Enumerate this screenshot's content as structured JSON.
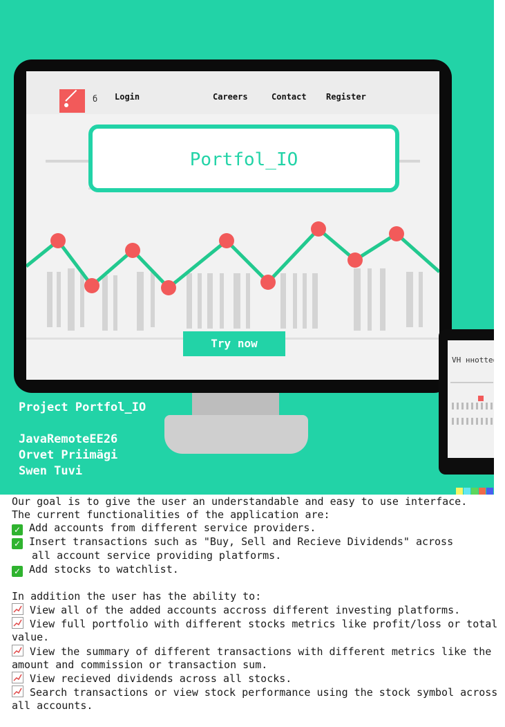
{
  "hero": {
    "nav": {
      "logo_glyph": "б",
      "links": [
        "Login",
        "Careers",
        "Contact",
        "Register"
      ]
    },
    "title": "Portfol_IO",
    "cta": "Try now",
    "project": "Project Portfol_IO",
    "team": [
      "JavaRemoteEE26",
      "Orvet Priimägi",
      "Swen Tuvi"
    ],
    "tablet_label": "VH ннotteɑ"
  },
  "description": {
    "intro": [
      "Our goal is to give the user an understandable and easy to use interface.",
      "The current functionalities of the application are:"
    ],
    "functions": [
      "Add accounts from different service providers.",
      "Insert transactions such as \"Buy, Sell and Recieve Dividends\" across",
      "Add stocks to watchlist."
    ],
    "function_continuation": "all account service providing platforms.",
    "addition_heading": "In addition the user has the ability to:",
    "abilities": [
      "View all of the added accounts accross different investing platforms.",
      "View full portfolio with different stocks metrics like profit/loss or total value.",
      "View the summary of different transactions with different metrics like the amount and commission or transaction sum.",
      "View recieved dividends across all stocks.",
      "Search transactions or view stock performance using the stock symbol across all accounts."
    ]
  },
  "colors": {
    "accent": "#22d3a7",
    "points": "#f25a5a",
    "check": "#2fb32f"
  }
}
